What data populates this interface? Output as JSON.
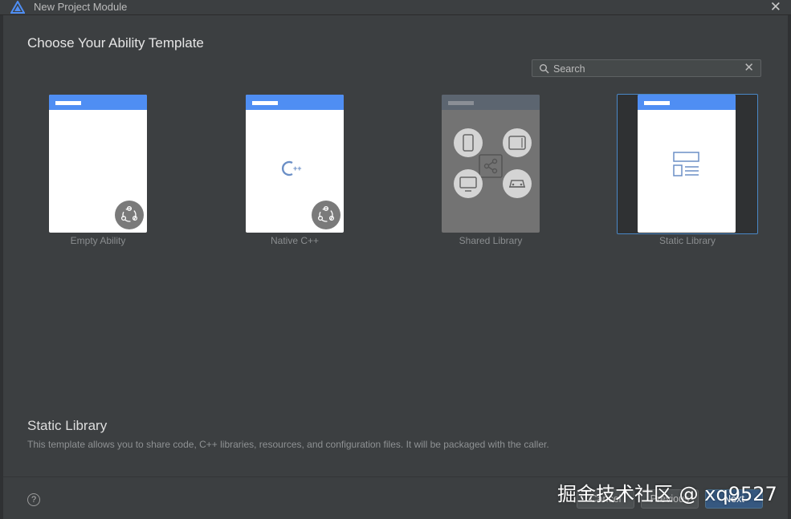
{
  "window": {
    "title": "New Project Module",
    "close_glyph": "✕"
  },
  "heading": "Choose Your Ability Template",
  "search": {
    "placeholder": "Search",
    "value": "",
    "clear_glyph": "✕"
  },
  "templates": [
    {
      "label": "Empty Ability",
      "icon": "ability-badge-icon"
    },
    {
      "label": "Native C++",
      "icon": "cpp-icon"
    },
    {
      "label": "Shared Library",
      "icon": "devices-icon"
    },
    {
      "label": "Static Library",
      "icon": "layout-icon",
      "selected": true
    }
  ],
  "cpp_text": "C++",
  "description": {
    "title": "Static Library",
    "text": "This template allows you to share code, C++ libraries, resources, and configuration files. It will be packaged with the caller."
  },
  "footer": {
    "help_glyph": "?",
    "cancel": "Cancel",
    "previous": "Previous",
    "next": "Next"
  },
  "watermark": "掘金技术社区 @ xq9527",
  "colors": {
    "accent": "#4f8ef3",
    "selection": "#4a88c7",
    "background": "#3c3f41"
  }
}
